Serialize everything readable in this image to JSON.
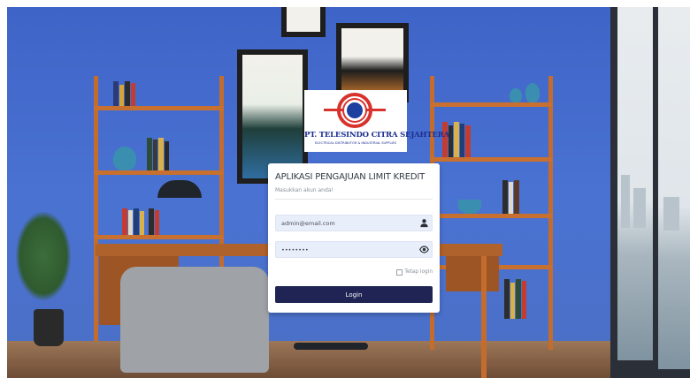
{
  "company": {
    "name": "PT. TELESINDO CITRA SEJAHTERA",
    "tagline": "ELECTRICAL DISTRIBUTOR & INDUSTRIAL SUPPLIES",
    "logo_mark": "TCS"
  },
  "login": {
    "title": "APLIKASI PENGAJUAN LIMIT KREDIT",
    "subtitle": "Masukkan akun anda!",
    "email_value": "admin@email.com",
    "password_value": "••••••••",
    "remember_label": "Tetap login",
    "remember_checked": false,
    "submit_label": "Login"
  },
  "icons": {
    "email": "user-icon",
    "password": "eye-icon"
  },
  "colors": {
    "wall": "#3f67c9",
    "button": "#1f2454",
    "field_bg": "#e9eefb",
    "logo_red": "#d8322d",
    "logo_blue": "#1d3fa0"
  }
}
